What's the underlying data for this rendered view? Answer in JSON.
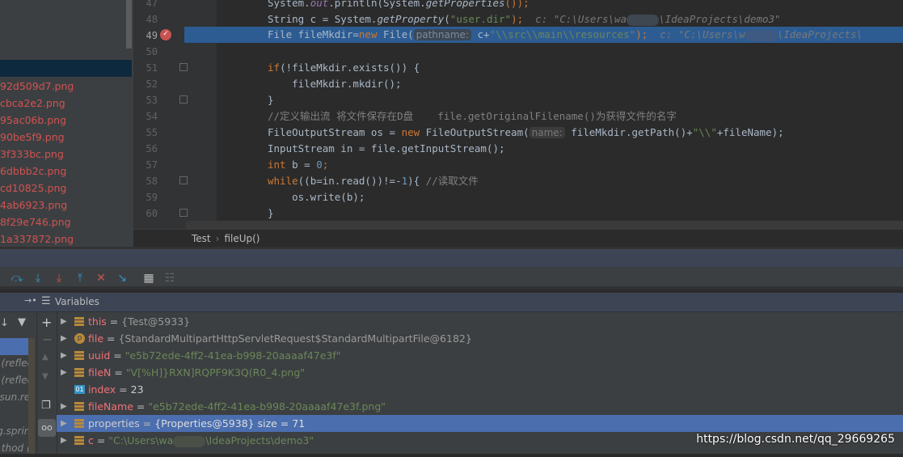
{
  "project_files": [
    "92d509d7.png",
    "cbca2e2.png",
    "95ac06b.png",
    "90be5f9.png",
    "3f333bc.png",
    "6dbbb2c.png",
    "cd10825.png",
    "4ab6923.png",
    "8f29e746.png",
    "1a337872.png"
  ],
  "line_numbers": [
    "47",
    "48",
    "49",
    "50",
    "51",
    "52",
    "53",
    "54",
    "55",
    "56",
    "57",
    "58",
    "59",
    "60"
  ],
  "code": {
    "l47a": "System.",
    "l47b": "out",
    "l47c": ".println(System.",
    "l47d": "getProperties",
    "l47e": "());",
    "l48a": "String c = System.",
    "l48b": "getProperty",
    "l48c": "(",
    "l48d": "\"user.dir\"",
    "l48e": ");",
    "l48f": "  c: \"C:\\Users\\wa",
    "l48g": "\\IdeaProjects\\demo3\"",
    "l49a": "File fileMkdir=",
    "l49b": "new",
    "l49c": " File(",
    "l49hint": "pathname:",
    "l49d": " c+",
    "l49e": "\"\\\\src\\\\main\\\\resources\"",
    "l49f": ");",
    "l49g": "  c: \"C:\\Users\\w",
    "l49h": "\\IdeaProjects\\",
    "l51a": "if",
    "l51b": "(!fileMkdir.exists()) {",
    "l52": "    fileMkdir.mkdir();",
    "l53": "}",
    "l54a": "//定义输出流 将文件保存在D盘",
    "l54b": "    file.getOriginalFilename()为获得文件的名字",
    "l55a": "FileOutputStream os = ",
    "l55b": "new",
    "l55c": " FileOutputStream(",
    "l55hint": "name:",
    "l55d": " fileMkdir.getPath()+",
    "l55e": "\"\\\\\"",
    "l55f": "+fileName);",
    "l56": "InputStream in = file.getInputStream();",
    "l57a": "int",
    "l57b": " b = ",
    "l57c": "0",
    "l57d": ";",
    "l58a": "while",
    "l58b": "((b=in.read())!=-",
    "l58c": "1",
    "l58d": "){ ",
    "l58e": "//读取文件",
    "l59": "    os.write(b);",
    "l60": "}"
  },
  "breadcrumb": [
    "Test",
    "›",
    "fileUp()"
  ],
  "variables_title": "Variables",
  "variables": [
    {
      "name": "this",
      "eq": " = ",
      "value": "{Test@5933}",
      "icon": "field-icon"
    },
    {
      "name": "file",
      "eq": " = ",
      "value": "{StandardMultipartHttpServletRequest$StandardMultipartFile@6182}",
      "icon": "parameter-icon"
    },
    {
      "name": "uuid",
      "eq": " = ",
      "value": "\"e5b72ede-4ff2-41ea-b998-20aaaaf47e3f\"",
      "icon": "field-icon"
    },
    {
      "name": "fileN",
      "eq": " = ",
      "value": "\"V[%H]}RXN]RQPF9K3Q(R0_4.png\"",
      "icon": "field-icon"
    },
    {
      "name": "index",
      "eq": " = ",
      "value": "23",
      "icon": "primitive-icon"
    },
    {
      "name": "fileName",
      "eq": " = ",
      "value": "\"e5b72ede-4ff2-41ea-b998-20aaaaf47e3f.png\"",
      "icon": "field-icon"
    },
    {
      "name": "properties",
      "eq": " = ",
      "value": "{Properties@5938}  size = 71",
      "icon": "field-icon"
    },
    {
      "name": "c",
      "eq": " = ",
      "value": "\"C:\\Users\\wa",
      "value2": "\\IdeaProjects\\demo3\"",
      "icon": "field-icon"
    }
  ],
  "frames": [
    "reflect)",
    "reflect)",
    "sun.refl",
    "g.spring",
    "thod (o"
  ],
  "watermark": "https://blog.csdn.net/qq_29669265"
}
